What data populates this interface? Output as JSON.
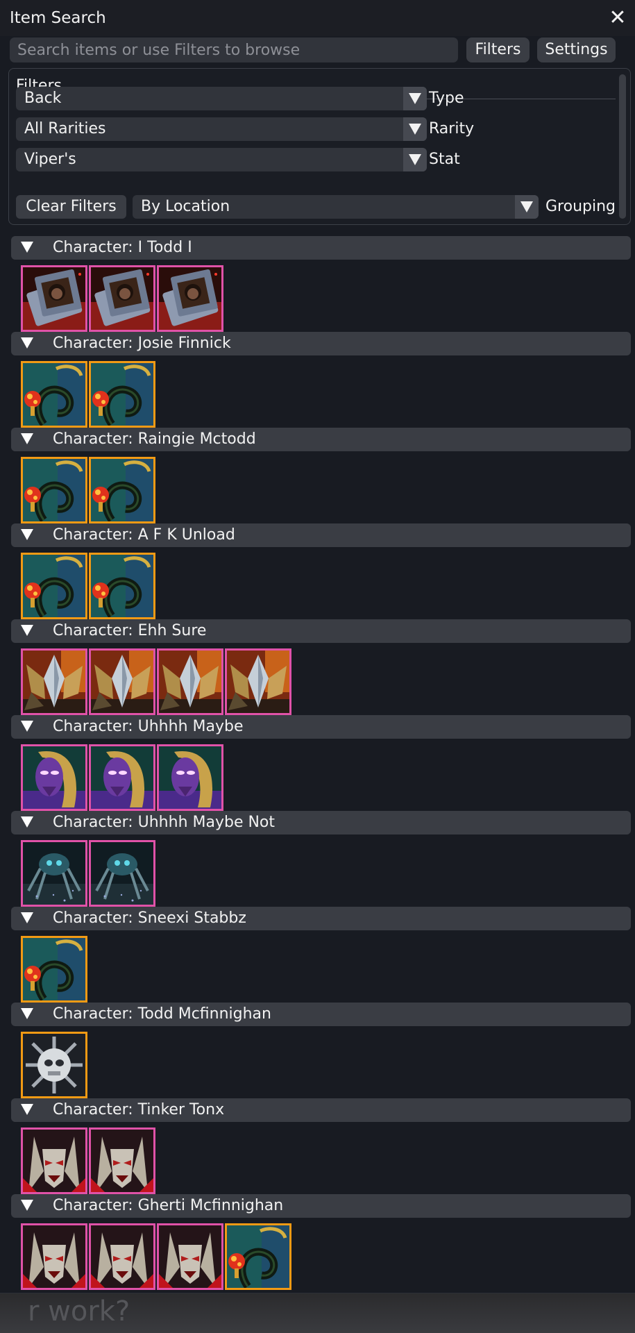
{
  "window": {
    "title": "Item Search"
  },
  "search": {
    "placeholder": "Search items or use Filters to browse",
    "value": ""
  },
  "toolbar": {
    "filters_label": "Filters",
    "settings_label": "Settings"
  },
  "filters": {
    "heading": "Filters",
    "type": {
      "value": "Back",
      "label": "Type"
    },
    "rarity": {
      "value": "All Rarities",
      "label": "Rarity"
    },
    "stat": {
      "value": "Viper's",
      "label": "Stat"
    },
    "clear_label": "Clear Filters",
    "grouping": {
      "value": "By Location",
      "label": "Grouping"
    }
  },
  "rarity_colors": {
    "legendary": "#e052a8",
    "ascended": "#f29a14"
  },
  "icon_names": {
    "book": "tome-backpack-icon",
    "serpent": "serpent-lantern-backpack-icon",
    "wings": "golden-wings-backpack-icon",
    "mask": "purple-mask-backpack-icon",
    "spider": "mechanical-spider-backpack-icon",
    "skull": "sun-skull-backpack-icon",
    "demon": "red-demon-backpack-icon"
  },
  "groups": [
    {
      "name": "Character: I Todd I",
      "items": [
        {
          "icon": "book",
          "rarity": "legendary"
        },
        {
          "icon": "book",
          "rarity": "legendary"
        },
        {
          "icon": "book",
          "rarity": "legendary"
        }
      ]
    },
    {
      "name": "Character: Josie Finnick",
      "items": [
        {
          "icon": "serpent",
          "rarity": "ascended"
        },
        {
          "icon": "serpent",
          "rarity": "ascended"
        }
      ]
    },
    {
      "name": "Character: Raingie Mctodd",
      "items": [
        {
          "icon": "serpent",
          "rarity": "ascended"
        },
        {
          "icon": "serpent",
          "rarity": "ascended"
        }
      ]
    },
    {
      "name": "Character: A F K Unload",
      "items": [
        {
          "icon": "serpent",
          "rarity": "ascended"
        },
        {
          "icon": "serpent",
          "rarity": "ascended"
        }
      ]
    },
    {
      "name": "Character: Ehh Sure",
      "items": [
        {
          "icon": "wings",
          "rarity": "legendary"
        },
        {
          "icon": "wings",
          "rarity": "legendary"
        },
        {
          "icon": "wings",
          "rarity": "legendary"
        },
        {
          "icon": "wings",
          "rarity": "legendary"
        }
      ]
    },
    {
      "name": "Character: Uhhhh Maybe",
      "items": [
        {
          "icon": "mask",
          "rarity": "legendary"
        },
        {
          "icon": "mask",
          "rarity": "legendary"
        },
        {
          "icon": "mask",
          "rarity": "legendary"
        }
      ]
    },
    {
      "name": "Character: Uhhhh Maybe Not",
      "items": [
        {
          "icon": "spider",
          "rarity": "legendary"
        },
        {
          "icon": "spider",
          "rarity": "legendary"
        }
      ]
    },
    {
      "name": "Character: Sneexi Stabbz",
      "items": [
        {
          "icon": "serpent",
          "rarity": "ascended"
        }
      ]
    },
    {
      "name": "Character: Todd Mcfinnighan",
      "items": [
        {
          "icon": "skull",
          "rarity": "ascended"
        }
      ]
    },
    {
      "name": "Character: Tinker Tonx",
      "items": [
        {
          "icon": "demon",
          "rarity": "legendary"
        },
        {
          "icon": "demon",
          "rarity": "legendary"
        }
      ]
    },
    {
      "name": "Character: Gherti Mcfinnighan",
      "items": [
        {
          "icon": "demon",
          "rarity": "legendary"
        },
        {
          "icon": "demon",
          "rarity": "legendary"
        },
        {
          "icon": "demon",
          "rarity": "legendary"
        },
        {
          "icon": "serpent",
          "rarity": "ascended"
        }
      ]
    }
  ],
  "background": {
    "text": "r work?"
  }
}
